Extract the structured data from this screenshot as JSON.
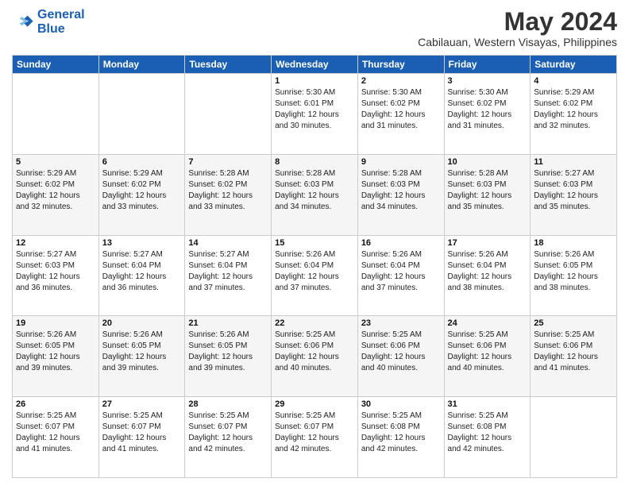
{
  "logo": {
    "line1": "General",
    "line2": "Blue"
  },
  "title": "May 2024",
  "subtitle": "Cabilauan, Western Visayas, Philippines",
  "days_of_week": [
    "Sunday",
    "Monday",
    "Tuesday",
    "Wednesday",
    "Thursday",
    "Friday",
    "Saturday"
  ],
  "weeks": [
    [
      {
        "day": "",
        "sunrise": "",
        "sunset": "",
        "daylight": ""
      },
      {
        "day": "",
        "sunrise": "",
        "sunset": "",
        "daylight": ""
      },
      {
        "day": "",
        "sunrise": "",
        "sunset": "",
        "daylight": ""
      },
      {
        "day": "1",
        "sunrise": "Sunrise: 5:30 AM",
        "sunset": "Sunset: 6:01 PM",
        "daylight": "Daylight: 12 hours and 30 minutes."
      },
      {
        "day": "2",
        "sunrise": "Sunrise: 5:30 AM",
        "sunset": "Sunset: 6:02 PM",
        "daylight": "Daylight: 12 hours and 31 minutes."
      },
      {
        "day": "3",
        "sunrise": "Sunrise: 5:30 AM",
        "sunset": "Sunset: 6:02 PM",
        "daylight": "Daylight: 12 hours and 31 minutes."
      },
      {
        "day": "4",
        "sunrise": "Sunrise: 5:29 AM",
        "sunset": "Sunset: 6:02 PM",
        "daylight": "Daylight: 12 hours and 32 minutes."
      }
    ],
    [
      {
        "day": "5",
        "sunrise": "Sunrise: 5:29 AM",
        "sunset": "Sunset: 6:02 PM",
        "daylight": "Daylight: 12 hours and 32 minutes."
      },
      {
        "day": "6",
        "sunrise": "Sunrise: 5:29 AM",
        "sunset": "Sunset: 6:02 PM",
        "daylight": "Daylight: 12 hours and 33 minutes."
      },
      {
        "day": "7",
        "sunrise": "Sunrise: 5:28 AM",
        "sunset": "Sunset: 6:02 PM",
        "daylight": "Daylight: 12 hours and 33 minutes."
      },
      {
        "day": "8",
        "sunrise": "Sunrise: 5:28 AM",
        "sunset": "Sunset: 6:03 PM",
        "daylight": "Daylight: 12 hours and 34 minutes."
      },
      {
        "day": "9",
        "sunrise": "Sunrise: 5:28 AM",
        "sunset": "Sunset: 6:03 PM",
        "daylight": "Daylight: 12 hours and 34 minutes."
      },
      {
        "day": "10",
        "sunrise": "Sunrise: 5:28 AM",
        "sunset": "Sunset: 6:03 PM",
        "daylight": "Daylight: 12 hours and 35 minutes."
      },
      {
        "day": "11",
        "sunrise": "Sunrise: 5:27 AM",
        "sunset": "Sunset: 6:03 PM",
        "daylight": "Daylight: 12 hours and 35 minutes."
      }
    ],
    [
      {
        "day": "12",
        "sunrise": "Sunrise: 5:27 AM",
        "sunset": "Sunset: 6:03 PM",
        "daylight": "Daylight: 12 hours and 36 minutes."
      },
      {
        "day": "13",
        "sunrise": "Sunrise: 5:27 AM",
        "sunset": "Sunset: 6:04 PM",
        "daylight": "Daylight: 12 hours and 36 minutes."
      },
      {
        "day": "14",
        "sunrise": "Sunrise: 5:27 AM",
        "sunset": "Sunset: 6:04 PM",
        "daylight": "Daylight: 12 hours and 37 minutes."
      },
      {
        "day": "15",
        "sunrise": "Sunrise: 5:26 AM",
        "sunset": "Sunset: 6:04 PM",
        "daylight": "Daylight: 12 hours and 37 minutes."
      },
      {
        "day": "16",
        "sunrise": "Sunrise: 5:26 AM",
        "sunset": "Sunset: 6:04 PM",
        "daylight": "Daylight: 12 hours and 37 minutes."
      },
      {
        "day": "17",
        "sunrise": "Sunrise: 5:26 AM",
        "sunset": "Sunset: 6:04 PM",
        "daylight": "Daylight: 12 hours and 38 minutes."
      },
      {
        "day": "18",
        "sunrise": "Sunrise: 5:26 AM",
        "sunset": "Sunset: 6:05 PM",
        "daylight": "Daylight: 12 hours and 38 minutes."
      }
    ],
    [
      {
        "day": "19",
        "sunrise": "Sunrise: 5:26 AM",
        "sunset": "Sunset: 6:05 PM",
        "daylight": "Daylight: 12 hours and 39 minutes."
      },
      {
        "day": "20",
        "sunrise": "Sunrise: 5:26 AM",
        "sunset": "Sunset: 6:05 PM",
        "daylight": "Daylight: 12 hours and 39 minutes."
      },
      {
        "day": "21",
        "sunrise": "Sunrise: 5:26 AM",
        "sunset": "Sunset: 6:05 PM",
        "daylight": "Daylight: 12 hours and 39 minutes."
      },
      {
        "day": "22",
        "sunrise": "Sunrise: 5:25 AM",
        "sunset": "Sunset: 6:06 PM",
        "daylight": "Daylight: 12 hours and 40 minutes."
      },
      {
        "day": "23",
        "sunrise": "Sunrise: 5:25 AM",
        "sunset": "Sunset: 6:06 PM",
        "daylight": "Daylight: 12 hours and 40 minutes."
      },
      {
        "day": "24",
        "sunrise": "Sunrise: 5:25 AM",
        "sunset": "Sunset: 6:06 PM",
        "daylight": "Daylight: 12 hours and 40 minutes."
      },
      {
        "day": "25",
        "sunrise": "Sunrise: 5:25 AM",
        "sunset": "Sunset: 6:06 PM",
        "daylight": "Daylight: 12 hours and 41 minutes."
      }
    ],
    [
      {
        "day": "26",
        "sunrise": "Sunrise: 5:25 AM",
        "sunset": "Sunset: 6:07 PM",
        "daylight": "Daylight: 12 hours and 41 minutes."
      },
      {
        "day": "27",
        "sunrise": "Sunrise: 5:25 AM",
        "sunset": "Sunset: 6:07 PM",
        "daylight": "Daylight: 12 hours and 41 minutes."
      },
      {
        "day": "28",
        "sunrise": "Sunrise: 5:25 AM",
        "sunset": "Sunset: 6:07 PM",
        "daylight": "Daylight: 12 hours and 42 minutes."
      },
      {
        "day": "29",
        "sunrise": "Sunrise: 5:25 AM",
        "sunset": "Sunset: 6:07 PM",
        "daylight": "Daylight: 12 hours and 42 minutes."
      },
      {
        "day": "30",
        "sunrise": "Sunrise: 5:25 AM",
        "sunset": "Sunset: 6:08 PM",
        "daylight": "Daylight: 12 hours and 42 minutes."
      },
      {
        "day": "31",
        "sunrise": "Sunrise: 5:25 AM",
        "sunset": "Sunset: 6:08 PM",
        "daylight": "Daylight: 12 hours and 42 minutes."
      },
      {
        "day": "",
        "sunrise": "",
        "sunset": "",
        "daylight": ""
      }
    ]
  ]
}
